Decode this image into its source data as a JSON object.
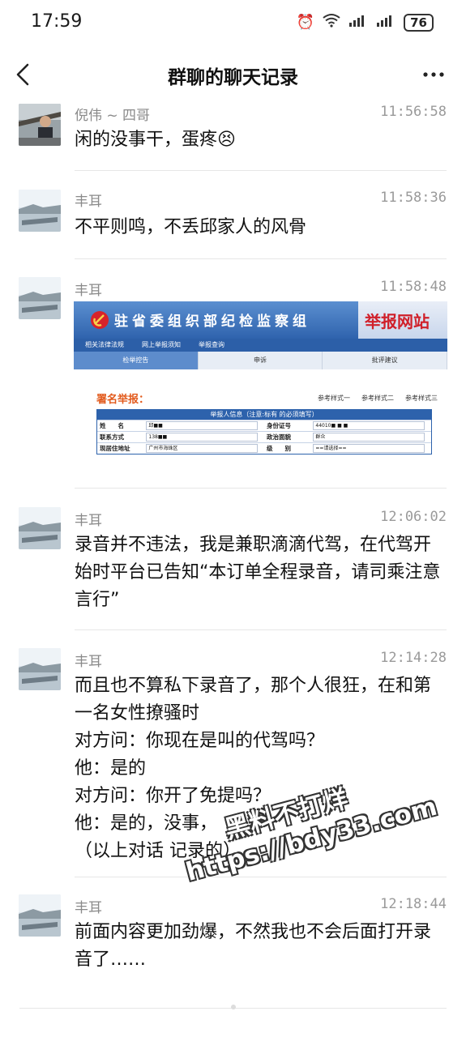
{
  "status_bar": {
    "time": "17:59",
    "battery": "76"
  },
  "nav": {
    "title": "群聊的聊天记录"
  },
  "messages": [
    {
      "sender": "倪伟 ~ 四哥",
      "time": "11:56:58",
      "text": "闲的没事干，蛋疼😣"
    },
    {
      "sender": "丰耳",
      "time": "11:58:36",
      "text": "不平则鸣，不丢邱家人的风骨"
    },
    {
      "sender": "丰耳",
      "time": "11:58:48",
      "text": ""
    },
    {
      "sender": "丰耳",
      "time": "12:06:02",
      "text": "录音并不违法，我是兼职滴滴代驾，在代驾开始时平台已告知“本订单全程录音，请司乘注意言行”"
    },
    {
      "sender": "丰耳",
      "time": "12:14:28",
      "text": "而且也不算私下录音了，那个人很狂，在和第一名女性撩骚时\n对方问：你现在是叫的代驾吗？\n他：是的\n对方问：你开了免提吗？\n他：是的，没事，\n（以上对话 记录的）"
    },
    {
      "sender": "丰耳",
      "time": "12:18:44",
      "text": "前面内容更加劲爆，不然我也不会后面打开录音了……"
    }
  ],
  "report_image": {
    "banner_title": "驻省委组织部纪检监察组",
    "banner_right": "举报网站",
    "links": [
      "相关法律法规",
      "网上举报须知",
      "举报查询"
    ],
    "tabs": [
      "检举控告",
      "申诉",
      "批评建议"
    ],
    "named_report": "署名举报：",
    "styles": [
      "参考样式一",
      "参考样式二",
      "参考样式三"
    ],
    "table_header": "举报人信息（注意:标有 的必须填写）",
    "rows": [
      {
        "l1": "姓　　名",
        "v1": "邱■■",
        "l2": "身份证号",
        "v2": "44010■ ■ ■"
      },
      {
        "l1": "联系方式",
        "v1": "138■■",
        "l2": "政治面貌",
        "v2": "群众"
      },
      {
        "l1": "现居住地址",
        "v1": "广州市海珠区",
        "l2": "级　　别",
        "v2": "==请选择=="
      }
    ]
  },
  "watermark": {
    "line1": "黑料不打烊",
    "line2": "https://bdy33.com"
  }
}
